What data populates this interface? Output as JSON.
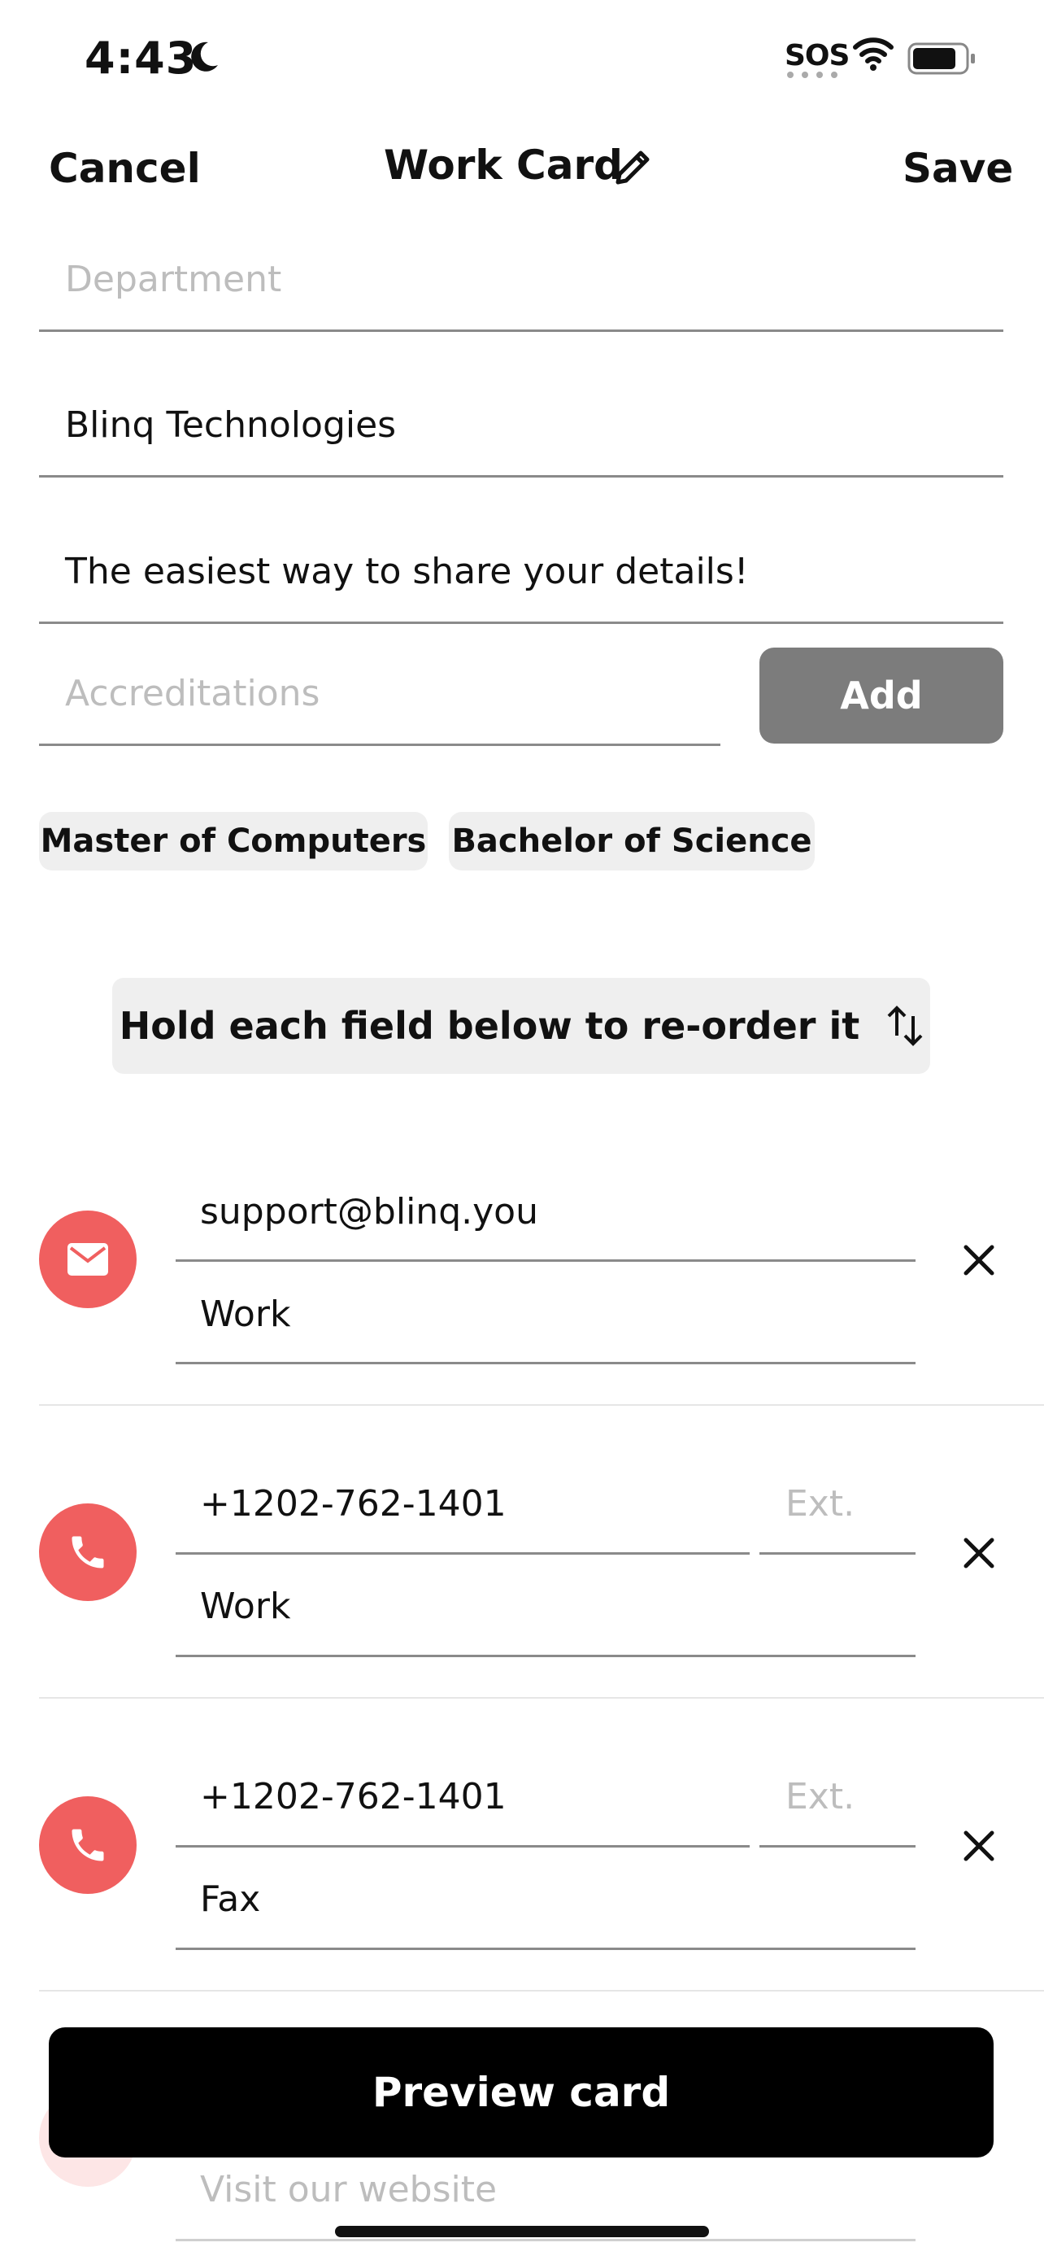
{
  "status_bar": {
    "time": "4:43",
    "sos": "SOS"
  },
  "nav": {
    "cancel": "Cancel",
    "title": "Work Card",
    "save": "Save"
  },
  "fields": {
    "department_placeholder": "Department",
    "company": "Blinq Technologies",
    "headline": "The easiest way to share your details!",
    "accreditations_placeholder": "Accreditations",
    "add_button": "Add"
  },
  "chips": [
    "Master of Computers",
    "Bachelor of Science"
  ],
  "hint": "Hold each field below to re-order it",
  "contact_fields": [
    {
      "icon": "email-icon",
      "value": "support@blinq.you",
      "label": "Work"
    },
    {
      "icon": "phone-icon",
      "value": "+1202-762-1401",
      "ext_placeholder": "Ext.",
      "label": "Work"
    },
    {
      "icon": "phone-icon",
      "value": "+1202-762-1401",
      "ext_placeholder": "Ext.",
      "label": "Fax"
    }
  ],
  "website_placeholder": "Visit our website",
  "preview_button": "Preview card",
  "colors": {
    "accent": "#f05f5f",
    "add_button": "#7c7c7c",
    "primary": "#000000"
  }
}
